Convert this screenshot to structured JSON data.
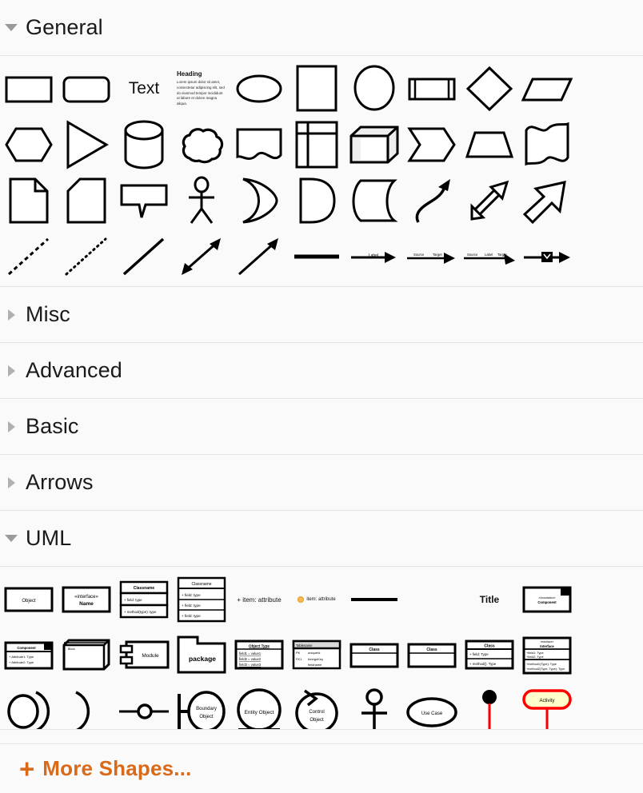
{
  "panel": {
    "title": "Shapes Panel",
    "background": "#fafafa",
    "divider_color": "#e4e4e4"
  },
  "sections": [
    {
      "id": "general",
      "label": "General",
      "expanded": true,
      "arrow": "chevron-down-icon"
    },
    {
      "id": "misc",
      "label": "Misc",
      "expanded": false,
      "arrow": "chevron-right-icon"
    },
    {
      "id": "advanced",
      "label": "Advanced",
      "expanded": false,
      "arrow": "chevron-right-icon"
    },
    {
      "id": "basic",
      "label": "Basic",
      "expanded": false,
      "arrow": "chevron-right-icon"
    },
    {
      "id": "arrows",
      "label": "Arrows",
      "expanded": false,
      "arrow": "chevron-right-icon"
    },
    {
      "id": "uml",
      "label": "UML",
      "expanded": true,
      "arrow": "chevron-down-icon"
    }
  ],
  "general_shapes": {
    "row1": [
      {
        "name": "rectangle",
        "title": "Rectangle"
      },
      {
        "name": "rounded-rectangle",
        "title": "Rounded Rectangle"
      },
      {
        "name": "text",
        "title": "Text",
        "text": "Text"
      },
      {
        "name": "textbox",
        "title": "Textbox",
        "heading": "Heading",
        "body": "Lorem ipsum dolor sit amet, consectetur adipiscing elit, sed do eiusmod tempor incididunt ut labore et dolore magna aliqua."
      },
      {
        "name": "ellipse",
        "title": "Ellipse"
      },
      {
        "name": "square",
        "title": "Square"
      },
      {
        "name": "circle",
        "title": "Circle"
      },
      {
        "name": "process",
        "title": "Process"
      },
      {
        "name": "diamond",
        "title": "Diamond"
      },
      {
        "name": "parallelogram",
        "title": "Parallelogram"
      }
    ],
    "row2": [
      {
        "name": "hexagon",
        "title": "Hexagon"
      },
      {
        "name": "triangle",
        "title": "Triangle"
      },
      {
        "name": "cylinder",
        "title": "Cylinder"
      },
      {
        "name": "cloud",
        "title": "Cloud"
      },
      {
        "name": "document",
        "title": "Document"
      },
      {
        "name": "internal-storage",
        "title": "Internal Storage"
      },
      {
        "name": "cube",
        "title": "Cube"
      },
      {
        "name": "step",
        "title": "Step"
      },
      {
        "name": "trapezoid",
        "title": "Trapezoid"
      },
      {
        "name": "tape",
        "title": "Tape"
      }
    ],
    "row3": [
      {
        "name": "note",
        "title": "Note"
      },
      {
        "name": "card",
        "title": "Card"
      },
      {
        "name": "callout",
        "title": "Callout"
      },
      {
        "name": "actor",
        "title": "Actor"
      },
      {
        "name": "or",
        "title": "Or"
      },
      {
        "name": "and",
        "title": "And"
      },
      {
        "name": "data-storage",
        "title": "Data Storage"
      },
      {
        "name": "curved-arrow",
        "title": "Curved Arrow"
      },
      {
        "name": "double-arrow",
        "title": "Double Arrow"
      },
      {
        "name": "arrow",
        "title": "Arrow"
      }
    ],
    "row4": [
      {
        "name": "dashed-line",
        "title": "Dashed Line"
      },
      {
        "name": "dotted-line",
        "title": "Dotted Line"
      },
      {
        "name": "line",
        "title": "Line"
      },
      {
        "name": "bidirectional-arrow",
        "title": "Bidirectional Arrow"
      },
      {
        "name": "directional-arrow",
        "title": "Directional Arrow"
      },
      {
        "name": "link",
        "title": "Link"
      },
      {
        "name": "connector-with-label",
        "title": "Connector with Label",
        "label": "Label"
      },
      {
        "name": "connector-with-2-labels",
        "title": "Connector with 2 Labels",
        "label_source": "Source",
        "label_target": "Target"
      },
      {
        "name": "connector-with-3-labels",
        "title": "Connector with 3 Labels",
        "label_source": "Source",
        "label_mid": "Label",
        "label_target": "Target"
      },
      {
        "name": "connector-with-symbol",
        "title": "Connector with Symbol"
      }
    ]
  },
  "uml_shapes": {
    "row1": [
      {
        "name": "object",
        "title": "Object",
        "text": "Object"
      },
      {
        "name": "interface",
        "title": "Interface",
        "stereotype": "«interface»",
        "text": "Name"
      },
      {
        "name": "class-3",
        "title": "Class 3",
        "header": "Classname",
        "field": "+ field: type",
        "method": "+ method(type): type"
      },
      {
        "name": "class-5",
        "title": "Class 5",
        "header": "Classname",
        "fields": [
          "+ field: type",
          "+ field: type",
          "+ field: type"
        ]
      },
      {
        "name": "item-1",
        "title": "Item 1",
        "text": "+ item: attribute"
      },
      {
        "name": "item-2",
        "title": "Item 2",
        "text": "item: attribute"
      },
      {
        "name": "divider",
        "title": "Divider"
      },
      {
        "name": "spacer",
        "title": "Spacer"
      },
      {
        "name": "title",
        "title": "Title",
        "text": "Title"
      },
      {
        "name": "annotated-component",
        "title": "Annotated Component",
        "stereotype": "«Annotation»",
        "text": "Component"
      }
    ],
    "row2": [
      {
        "name": "component",
        "title": "Component",
        "header": "Component",
        "attrs": [
          "+ Attribute1: Type",
          "+ Attribute2: Type"
        ]
      },
      {
        "name": "block",
        "title": "Block",
        "text": "Block"
      },
      {
        "name": "module",
        "title": "Module",
        "text": "Module"
      },
      {
        "name": "package",
        "title": "Package",
        "text": "package"
      },
      {
        "name": "object-type",
        "title": "Object Type",
        "header": "Object Type",
        "fields": [
          "field1 = value1",
          "field2 = value2",
          "field3 = value3"
        ]
      },
      {
        "name": "table",
        "title": "Table",
        "header": "Tablename",
        "rows": [
          [
            "PK",
            "uniqueId"
          ],
          [
            "FK1",
            "foreignKey"
          ],
          [
            "",
            "fieldname"
          ]
        ]
      },
      {
        "name": "class-simple",
        "title": "Class",
        "header": "Class"
      },
      {
        "name": "class-2",
        "title": "Class 2",
        "header": "Class"
      },
      {
        "name": "class-4",
        "title": "Class 4",
        "header": "Class",
        "field": "+ field: Type",
        "method": "+ method(): Type"
      },
      {
        "name": "interface-2",
        "title": "Interface 2",
        "stereotype": "«interface»",
        "header": "Interface",
        "fields": [
          "+field1: Type",
          "+field2: Type"
        ],
        "methods": [
          "+method1(Type): Type",
          "+method2(Type, Type): Type"
        ]
      }
    ],
    "row3": [
      {
        "name": "provided-required-interface",
        "title": "Provided/Required Interface"
      },
      {
        "name": "required-interface",
        "title": "Required Interface"
      },
      {
        "name": "lollipop-notation",
        "title": "Lollipop Notation"
      },
      {
        "name": "boundary-object",
        "title": "Boundary Object",
        "text": "Boundary Object"
      },
      {
        "name": "entity-object",
        "title": "Entity Object",
        "text": "Entity Object"
      },
      {
        "name": "control-object",
        "title": "Control Object",
        "text": "Control Object"
      },
      {
        "name": "actor",
        "title": "Actor"
      },
      {
        "name": "use-case",
        "title": "Use Case",
        "text": "Use Case"
      },
      {
        "name": "activation",
        "title": "Activation"
      },
      {
        "name": "activity",
        "title": "Activity",
        "text": "Activity",
        "fill": "#ffffcc",
        "stroke": "#ff0000"
      }
    ]
  },
  "footer": {
    "plus": "+",
    "label": "More Shapes...",
    "color": "#d96a19"
  }
}
